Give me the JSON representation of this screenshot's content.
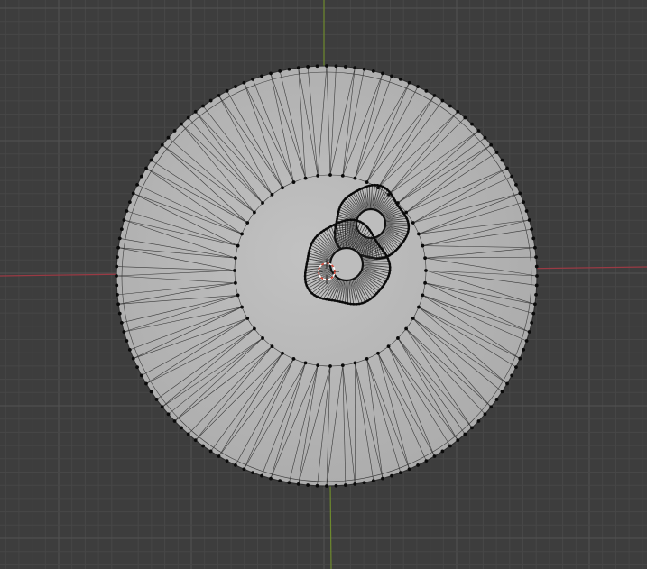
{
  "viewport": {
    "background_color": "#3d3d3d",
    "grid_minor_color": "#474747",
    "grid_major_color": "#525252",
    "x_axis_color": "#9a3a44",
    "y_axis_color": "#6e8a2d"
  },
  "mesh": {
    "face_color": "#b7b7b7",
    "edge_color": "#3a3a3a",
    "vertex_color": "#0a0a0a",
    "outer_ring_vertex_count": 140,
    "inner_ring_vertex_count": 48,
    "hole_vertex_count": 90
  },
  "origin": {
    "cursor_colors": [
      "#d94a3a",
      "#ffffff"
    ]
  }
}
